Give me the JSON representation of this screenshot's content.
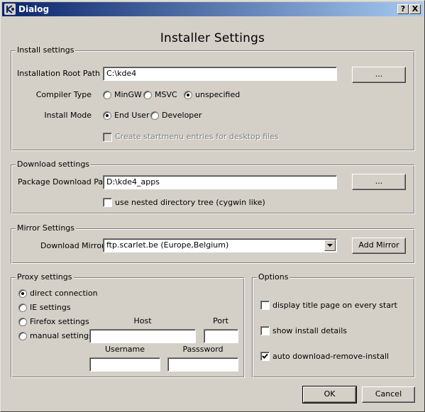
{
  "window": {
    "title": "Dialog",
    "help_label": "?",
    "close_label": "X"
  },
  "heading": "Installer Settings",
  "install": {
    "legend": "Install settings",
    "root_label": "Installation Root Path",
    "root_value": "C:\\kde4",
    "browse_label": "...",
    "compiler_label": "Compiler Type",
    "compiler_options": [
      "MinGW",
      "MSVC",
      "unspecified"
    ],
    "compiler_selected": "unspecified",
    "mode_label": "Install Mode",
    "mode_options": [
      "End User",
      "Developer"
    ],
    "mode_selected": "End User",
    "startmenu_label": "Create startmenu entries for desktop files",
    "startmenu_checked": false
  },
  "download": {
    "legend": "Download settings",
    "path_label": "Package Download Path",
    "path_value": "D:\\kde4_apps",
    "browse_label": "...",
    "nested_label": "use nested directory tree (cygwin like)",
    "nested_checked": false
  },
  "mirror": {
    "legend": "Mirror Settings",
    "label": "Download Mirror",
    "selected": "ftp.scarlet.be (Europe,Belgium)",
    "add_label": "Add Mirror"
  },
  "proxy": {
    "legend": "Proxy settings",
    "options": [
      "direct connection",
      "IE settings",
      "Firefox settings",
      "manual settings"
    ],
    "selected": "direct connection",
    "host_label": "Host",
    "port_label": "Port",
    "username_label": "Username",
    "password_label": "Passsword",
    "host_value": "",
    "port_value": "",
    "username_value": "",
    "password_value": ""
  },
  "options": {
    "legend": "Options",
    "title_page_label": "display title page on every start",
    "title_page_checked": false,
    "details_label": "show install details",
    "details_checked": false,
    "auto_label": "auto download-remove-install",
    "auto_checked": true
  },
  "footer": {
    "ok_label": "OK",
    "cancel_label": "Cancel"
  }
}
